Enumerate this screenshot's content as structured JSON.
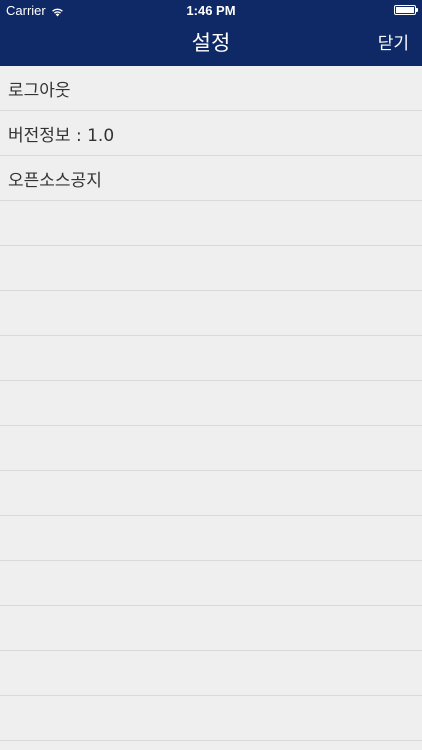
{
  "status_bar": {
    "carrier": "Carrier",
    "time": "1:46 PM",
    "wifi_icon": "wifi-icon",
    "battery_icon": "battery-icon",
    "battery_level": 1.0
  },
  "nav_bar": {
    "title": "설정",
    "close_label": "닫기",
    "background": "#0f2966"
  },
  "settings": {
    "items": [
      {
        "label": "로그아웃"
      },
      {
        "label": "버전정보 : 1.0"
      },
      {
        "label": "오픈소스공지"
      }
    ],
    "empty_rows": 12
  }
}
